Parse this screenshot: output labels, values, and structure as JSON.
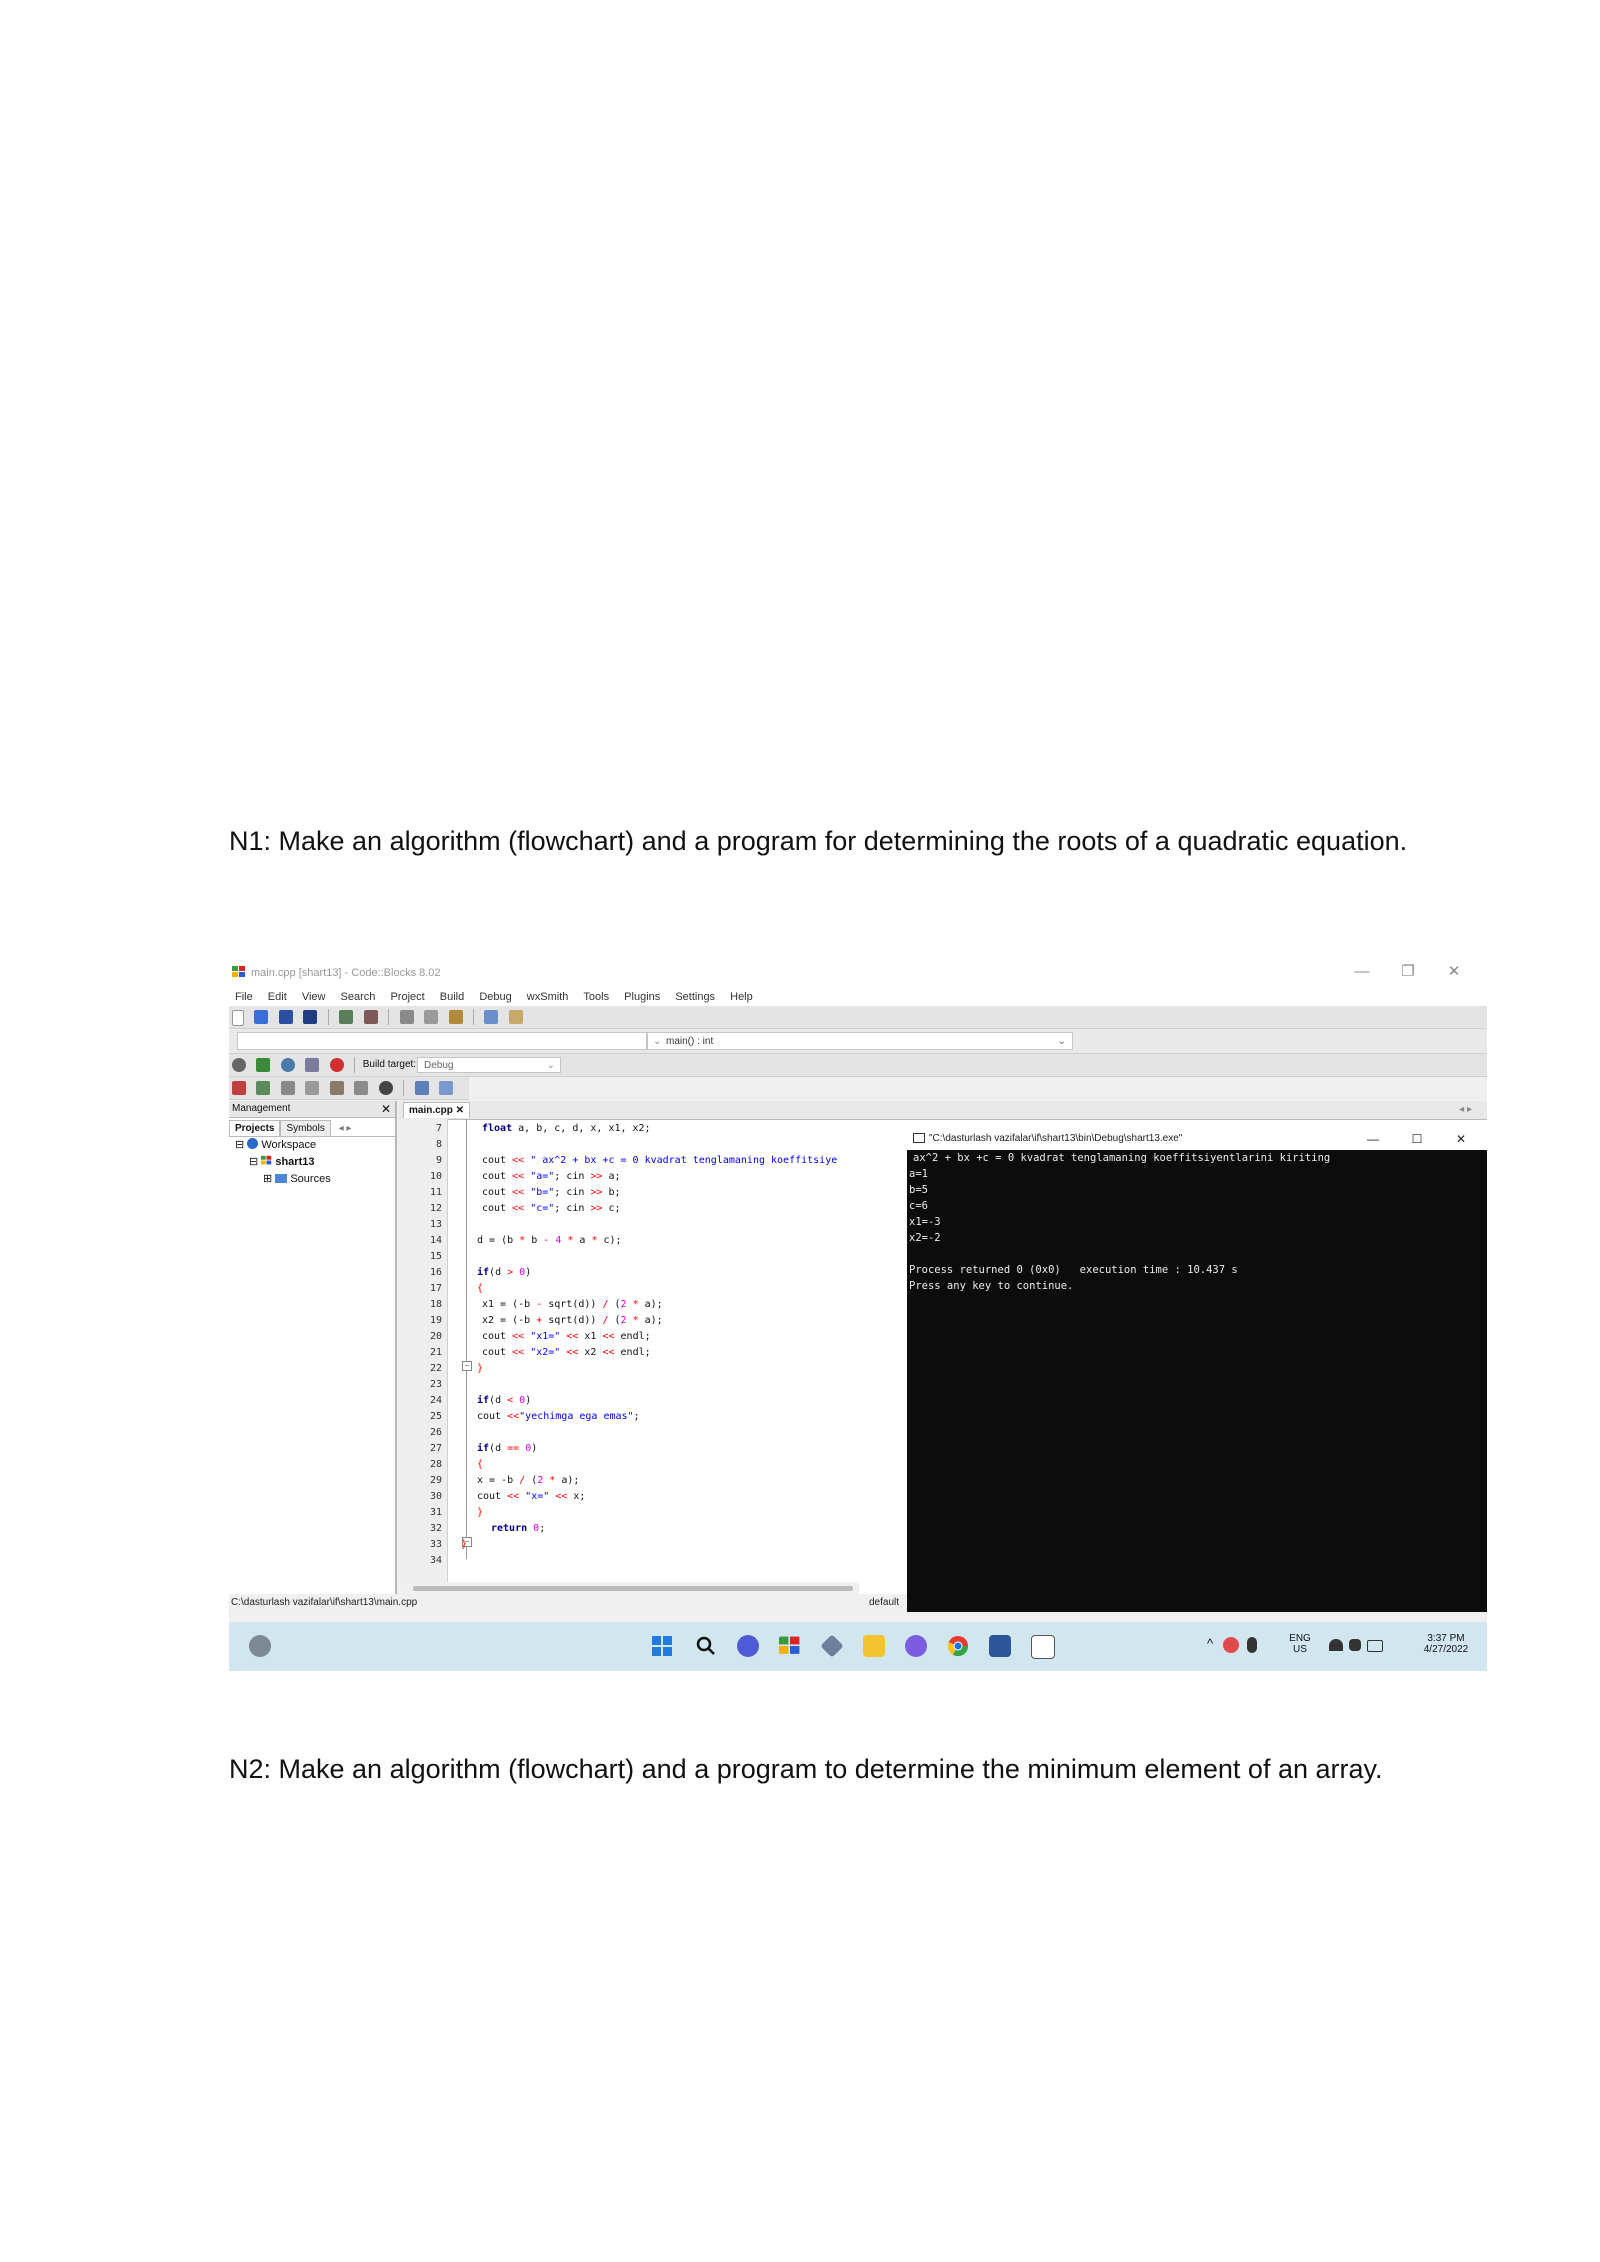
{
  "headings": {
    "n1": "N1: Make an algorithm (flowchart) and a program for determining the roots of a quadratic equation.",
    "n2": "N2: Make an algorithm (flowchart) and a program to determine the minimum element of an array."
  },
  "screenshot": {
    "window_title": "main.cpp [shart13] - Code::Blocks 8.02",
    "window_buttons": [
      "—",
      "❐",
      "✕"
    ],
    "menu": [
      "File",
      "Edit",
      "View",
      "Search",
      "Project",
      "Build",
      "Debug",
      "wxSmith",
      "Tools",
      "Plugins",
      "Settings",
      "Help"
    ],
    "function_combo": "main() : int",
    "build_target_label": "Build target:",
    "build_target_value": "Debug",
    "management": {
      "title": "Management",
      "close": "✕",
      "tabs": [
        "Projects",
        "Symbols"
      ],
      "tree": [
        "Workspace",
        "shart13",
        "Sources"
      ]
    },
    "editor": {
      "tab": "main.cpp ✕",
      "line_numbers": [
        "7",
        "8",
        "9",
        "10",
        "11",
        "12",
        "13",
        "14",
        "15",
        "16",
        "17",
        "18",
        "19",
        "20",
        "21",
        "22",
        "23",
        "24",
        "25",
        "26",
        "27",
        "28",
        "29",
        "30",
        "31",
        "32",
        "33",
        "34"
      ]
    },
    "status_path": "C:\\dasturlash vazifalar\\if\\shart13\\main.cpp",
    "status_right": "default",
    "console": {
      "title": "\"C:\\dasturlash vazifalar\\if\\shart13\\bin\\Debug\\shart13.exe\"",
      "buttons": [
        "—",
        "☐",
        "✕"
      ],
      "lines": [
        "ax^2 + bx +c = 0 kvadrat tenglamaning koeffitsiyentlarini kiriting",
        "a=1",
        "b=5",
        "c=6",
        "x1=-3",
        "x2=-2",
        "",
        "Process returned 0 (0x0)   execution time : 10.437 s",
        "Press any key to continue."
      ]
    },
    "tray": {
      "lang_top": "ENG",
      "lang_bottom": "US",
      "time": "3:37 PM",
      "date": "4/27/2022"
    },
    "colors": {
      "keyword": "#00008b",
      "string": "#0000ff",
      "number": "#e000e0",
      "operator": "#ff0000",
      "console_bg": "#0c0c0c",
      "taskbar": "#d2e6f0"
    }
  }
}
